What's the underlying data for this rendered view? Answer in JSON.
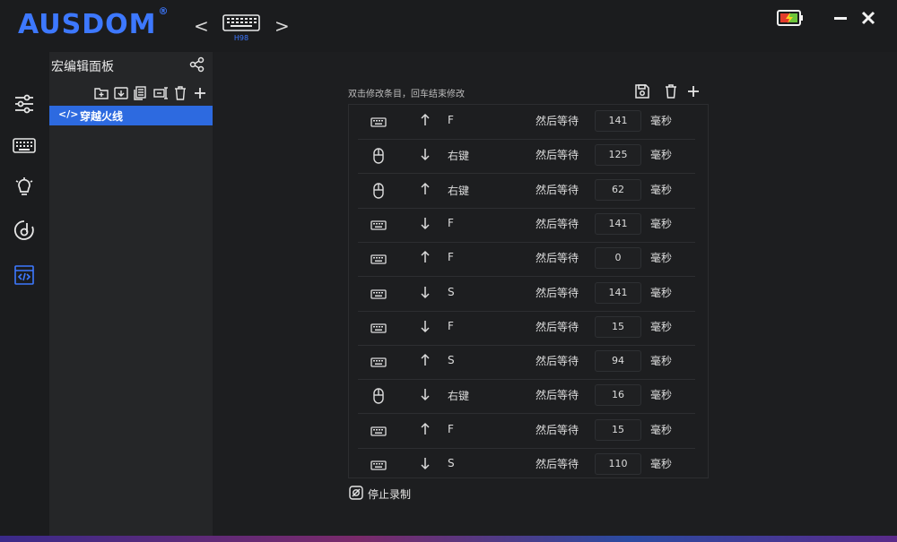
{
  "app": {
    "brand": "AUSDOM",
    "brand_mark": "®",
    "device_label": "H98",
    "nav_prev": "<",
    "nav_next": ">"
  },
  "leftbar": {
    "items": [
      {
        "icon": "sliders-icon"
      },
      {
        "icon": "keyboard-icon"
      },
      {
        "icon": "lightbulb-icon"
      },
      {
        "icon": "dpi-icon"
      },
      {
        "icon": "macro-icon",
        "active": true
      }
    ]
  },
  "sidebar": {
    "title": "宏编辑面板",
    "items": [
      {
        "code": "</>",
        "label": "穿越火线",
        "selected": true
      }
    ]
  },
  "editor": {
    "hint": "双击修改条目，回车结束修改",
    "stop_label": "停止录制",
    "rows": [
      {
        "device": "keyboard",
        "direction": "up",
        "key": "F",
        "then": "然后等待",
        "delay": "141",
        "unit": "毫秒"
      },
      {
        "device": "mouse",
        "direction": "down",
        "key": "右键",
        "then": "然后等待",
        "delay": "125",
        "unit": "毫秒"
      },
      {
        "device": "mouse",
        "direction": "up",
        "key": "右键",
        "then": "然后等待",
        "delay": "62",
        "unit": "毫秒"
      },
      {
        "device": "keyboard",
        "direction": "down",
        "key": "F",
        "then": "然后等待",
        "delay": "141",
        "unit": "毫秒"
      },
      {
        "device": "keyboard",
        "direction": "up",
        "key": "F",
        "then": "然后等待",
        "delay": "0",
        "unit": "毫秒"
      },
      {
        "device": "keyboard",
        "direction": "down",
        "key": "S",
        "then": "然后等待",
        "delay": "141",
        "unit": "毫秒"
      },
      {
        "device": "keyboard",
        "direction": "down",
        "key": "F",
        "then": "然后等待",
        "delay": "15",
        "unit": "毫秒"
      },
      {
        "device": "keyboard",
        "direction": "up",
        "key": "S",
        "then": "然后等待",
        "delay": "94",
        "unit": "毫秒"
      },
      {
        "device": "mouse",
        "direction": "down",
        "key": "右键",
        "then": "然后等待",
        "delay": "16",
        "unit": "毫秒"
      },
      {
        "device": "keyboard",
        "direction": "up",
        "key": "F",
        "then": "然后等待",
        "delay": "15",
        "unit": "毫秒"
      },
      {
        "device": "keyboard",
        "direction": "down",
        "key": "S",
        "then": "然后等待",
        "delay": "110",
        "unit": "毫秒"
      }
    ]
  },
  "colors": {
    "accent": "#2d6ae0",
    "brand": "#3d78ff",
    "battery_fill": "#e23c2c",
    "bolt": "#ffd21e"
  }
}
